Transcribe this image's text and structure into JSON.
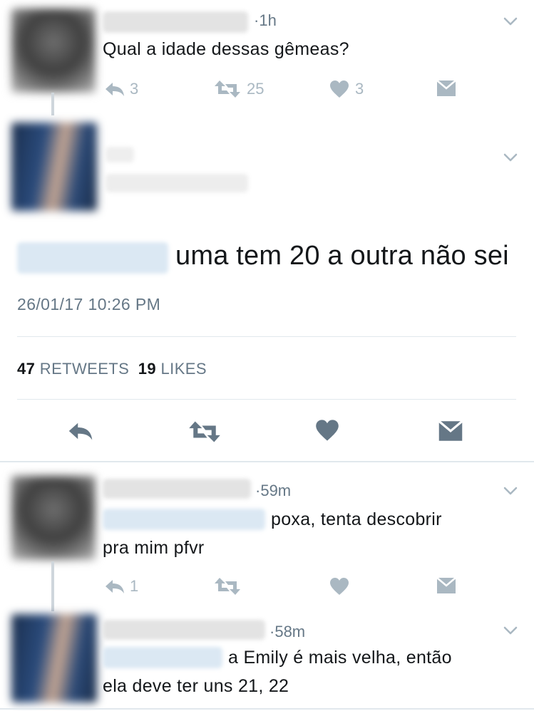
{
  "tweet1": {
    "time": "1h",
    "text": "Qual a idade dessas gêmeas?",
    "replies": "3",
    "retweets": "25",
    "likes": "3"
  },
  "main": {
    "text": "uma tem 20 a outra não sei",
    "timestamp": "26/01/17 10:26 PM",
    "retweets_count": "47",
    "retweets_label": "RETWEETS",
    "likes_count": "19",
    "likes_label": "LIKES"
  },
  "reply1": {
    "time": "59m",
    "text_line1": "poxa, tenta descobrir",
    "text_line2": "pra mim pfvr",
    "replies": "1"
  },
  "reply2": {
    "time": "58m",
    "text_line1": "a Emily é mais velha, então",
    "text_line2": "ela deve ter uns 21, 22"
  },
  "colors": {
    "muted": "#aab8c2",
    "text": "#14171a",
    "secondary": "#657786",
    "divider": "#e1e8ed"
  },
  "icons": [
    "reply-icon",
    "retweet-icon",
    "like-icon",
    "direct-message-icon",
    "chevron-down-icon"
  ]
}
